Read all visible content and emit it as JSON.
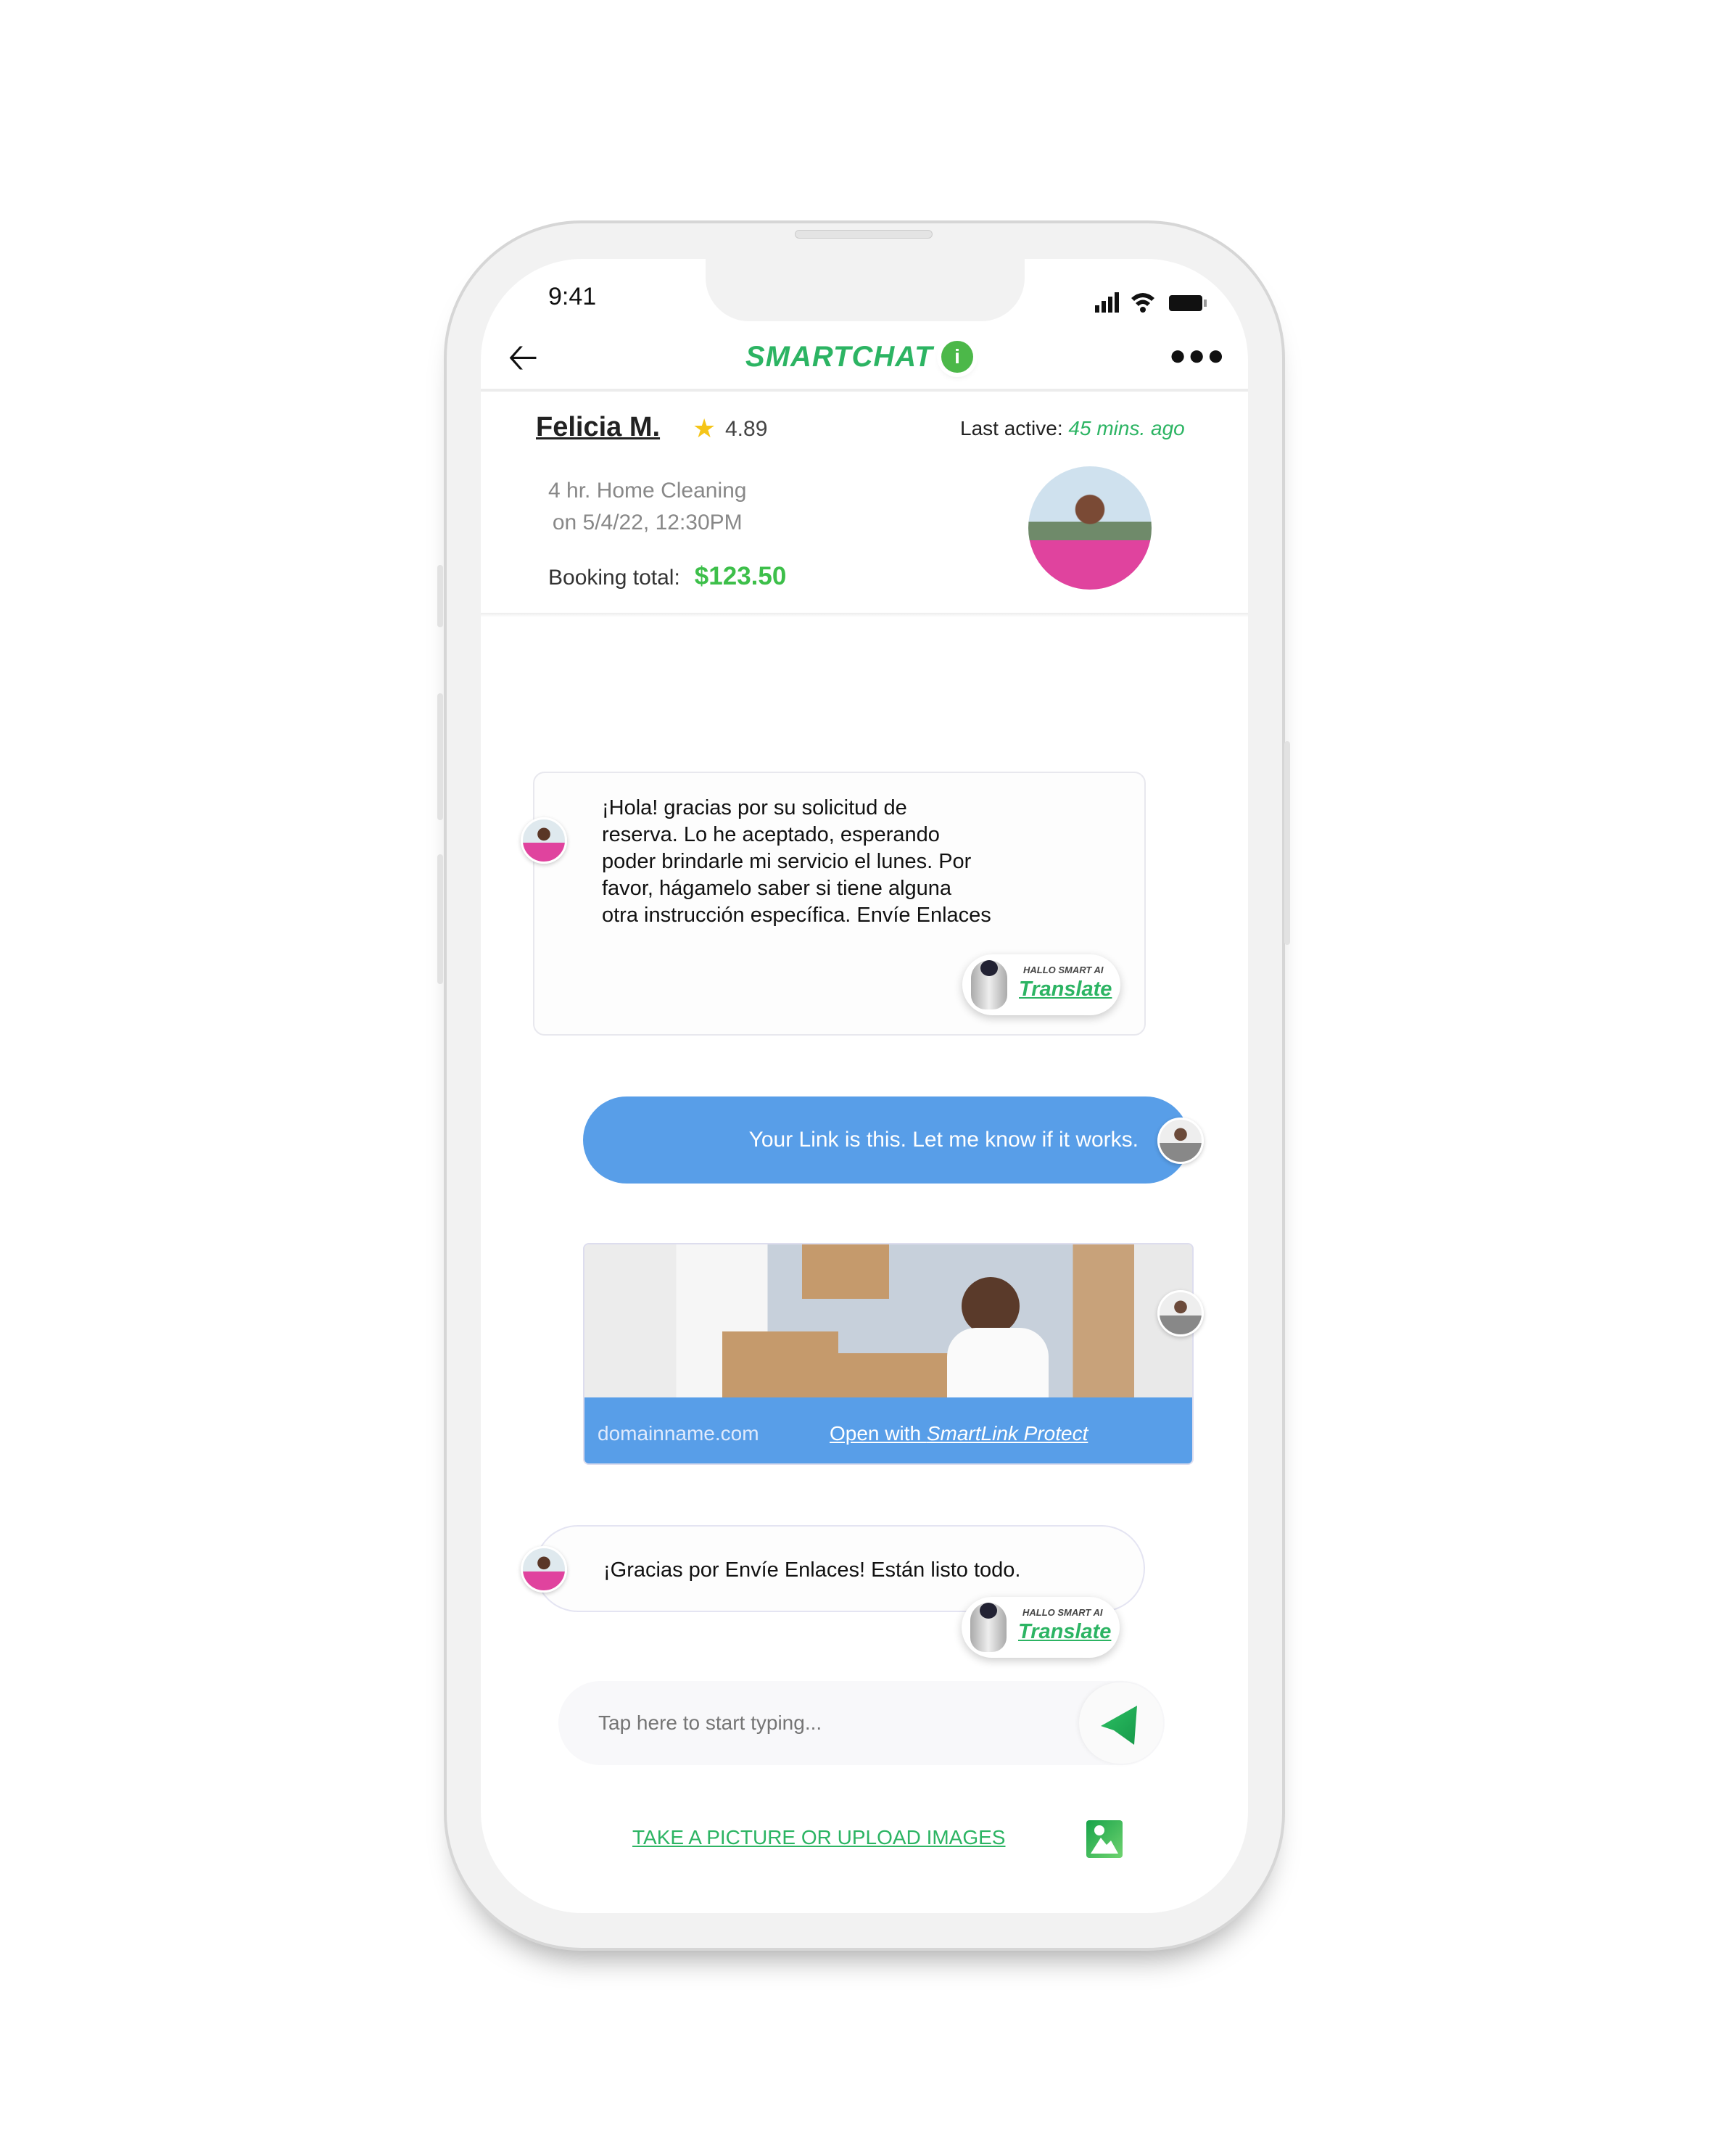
{
  "status_bar": {
    "time": "9:41"
  },
  "header": {
    "title": "SMARTCHAT",
    "info_icon": "info-icon",
    "back_icon": "arrow-left-icon",
    "menu_icon": "more-horizontal-icon"
  },
  "provider": {
    "name": "Felicia M.",
    "rating": "4.89",
    "last_active_label": "Last active:",
    "last_active_value": "45 mins. ago",
    "service_line1": "4 hr. Home Cleaning",
    "service_line2": "on 5/4/22, 12:30PM",
    "booking_total_label": "Booking total:",
    "booking_total_value": "$123.50"
  },
  "messages": [
    {
      "from": "provider",
      "text": "¡Hola! gracias por su solicitud de reserva. Lo he aceptado, esperando poder brindarle mi servicio el lunes. Por favor, hágamelo saber si tiene alguna otra instrucción específica. Envíe Enlaces",
      "lines": [
        "¡Hola! gracias por su solicitud de",
        "reserva. Lo he aceptado, esperando",
        "poder brindarle mi servicio el lunes. Por",
        "favor, hágamelo saber si tiene alguna",
        "otra instrucción específica. Envíe Enlaces"
      ]
    },
    {
      "from": "user",
      "text": "Your Link is this. Let me know if it works."
    },
    {
      "from": "user",
      "type": "link",
      "domain": "domainname.com",
      "open_prefix": "Open with ",
      "open_brand": "SmartLink Protect"
    },
    {
      "from": "provider",
      "text": "¡Gracias por Envíe Enlaces! Están listo todo."
    }
  ],
  "translate_badge": {
    "small": "HALLO SMART AI",
    "label": "Translate"
  },
  "composer": {
    "placeholder": "Tap here to start typing...",
    "send_icon": "send-icon"
  },
  "upload": {
    "label": "TAKE A PICTURE OR UPLOAD IMAGES",
    "icon": "image-icon"
  },
  "colors": {
    "brand_green": "#2cb463",
    "price_green": "#3dbf4a",
    "bubble_blue": "#589ee8"
  }
}
